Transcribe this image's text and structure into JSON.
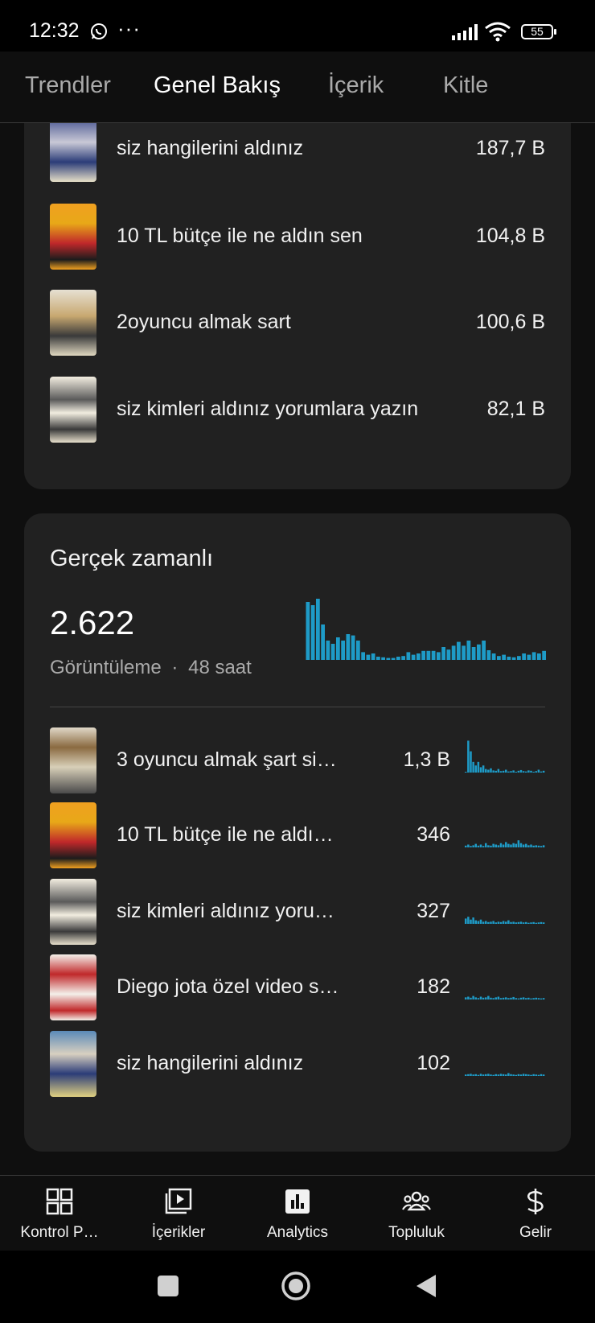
{
  "status": {
    "time": "12:32",
    "battery": "55"
  },
  "tabs": [
    {
      "label": "Trendler"
    },
    {
      "label": "Genel Bakış"
    },
    {
      "label": "İçerik"
    },
    {
      "label": "Kitle"
    }
  ],
  "top_content": [
    {
      "title": "siz hangilerini aldınız",
      "value": "187,7 B"
    },
    {
      "title": "10 TL bütçe ile ne  aldın sen",
      "value": "104,8 B"
    },
    {
      "title": "2oyuncu almak sart",
      "value": "100,6 B"
    },
    {
      "title": "siz kimleri aldınız yorumlara yazın",
      "value": "82,1 B"
    }
  ],
  "realtime": {
    "title": "Gerçek zamanlı",
    "views": "2.622",
    "views_label": "Görüntüleme",
    "separator": "·",
    "period": "48 saat",
    "bars": [
      0.9,
      0.85,
      0.95,
      0.55,
      0.3,
      0.25,
      0.35,
      0.3,
      0.4,
      0.38,
      0.3,
      0.12,
      0.08,
      0.1,
      0.05,
      0.04,
      0.03,
      0.03,
      0.05,
      0.06,
      0.12,
      0.08,
      0.1,
      0.14,
      0.14,
      0.14,
      0.12,
      0.2,
      0.16,
      0.22,
      0.28,
      0.22,
      0.3,
      0.2,
      0.24,
      0.3,
      0.15,
      0.1,
      0.06,
      0.08,
      0.05,
      0.04,
      0.06,
      0.1,
      0.08,
      0.12,
      0.1,
      0.14
    ],
    "items": [
      {
        "title": "3 oyuncu almak şart si…",
        "value": "1,3 B",
        "spark": [
          0.02,
          0.9,
          0.6,
          0.3,
          0.2,
          0.3,
          0.15,
          0.2,
          0.1,
          0.08,
          0.12,
          0.06,
          0.05,
          0.1,
          0.04,
          0.05,
          0.08,
          0.03,
          0.04,
          0.06,
          0.02,
          0.05,
          0.07,
          0.04,
          0.03,
          0.06,
          0.05,
          0.02,
          0.04,
          0.08,
          0.03,
          0.05
        ]
      },
      {
        "title": "10 TL bütçe ile ne  aldı…",
        "value": "346",
        "spark": [
          0.05,
          0.08,
          0.04,
          0.06,
          0.1,
          0.05,
          0.08,
          0.04,
          0.12,
          0.06,
          0.05,
          0.1,
          0.08,
          0.06,
          0.12,
          0.08,
          0.15,
          0.1,
          0.08,
          0.12,
          0.1,
          0.2,
          0.12,
          0.08,
          0.1,
          0.06,
          0.08,
          0.05,
          0.06,
          0.05,
          0.04,
          0.06
        ]
      },
      {
        "title": "siz kimleri aldınız yoru…",
        "value": "327",
        "spark": [
          0.15,
          0.2,
          0.12,
          0.18,
          0.1,
          0.08,
          0.12,
          0.06,
          0.08,
          0.05,
          0.06,
          0.08,
          0.04,
          0.06,
          0.05,
          0.08,
          0.06,
          0.1,
          0.05,
          0.06,
          0.04,
          0.05,
          0.06,
          0.04,
          0.05,
          0.03,
          0.04,
          0.05,
          0.03,
          0.04,
          0.05,
          0.04
        ]
      },
      {
        "title": "Diego jota özel video s…",
        "value": "182",
        "spark": [
          0.06,
          0.08,
          0.05,
          0.1,
          0.06,
          0.04,
          0.08,
          0.05,
          0.06,
          0.1,
          0.05,
          0.04,
          0.06,
          0.08,
          0.04,
          0.05,
          0.06,
          0.04,
          0.05,
          0.07,
          0.04,
          0.03,
          0.05,
          0.06,
          0.04,
          0.05,
          0.03,
          0.04,
          0.05,
          0.04,
          0.03,
          0.04
        ]
      },
      {
        "title": "siz hangilerini aldınız",
        "value": "102",
        "spark": [
          0.04,
          0.05,
          0.06,
          0.04,
          0.05,
          0.03,
          0.06,
          0.04,
          0.05,
          0.06,
          0.04,
          0.03,
          0.05,
          0.04,
          0.06,
          0.05,
          0.04,
          0.08,
          0.05,
          0.04,
          0.03,
          0.05,
          0.04,
          0.06,
          0.05,
          0.04,
          0.03,
          0.05,
          0.04,
          0.03,
          0.05,
          0.04
        ]
      }
    ]
  },
  "bottom_nav": [
    {
      "label": "Kontrol P…",
      "icon": "dashboard-icon"
    },
    {
      "label": "İçerikler",
      "icon": "content-play-icon"
    },
    {
      "label": "Analytics",
      "icon": "analytics-icon"
    },
    {
      "label": "Topluluk",
      "icon": "community-icon"
    },
    {
      "label": "Gelir",
      "icon": "dollar-icon"
    }
  ],
  "colors": {
    "accent": "#1e9bc7",
    "card": "#212121",
    "bg": "#0f0f0f"
  }
}
